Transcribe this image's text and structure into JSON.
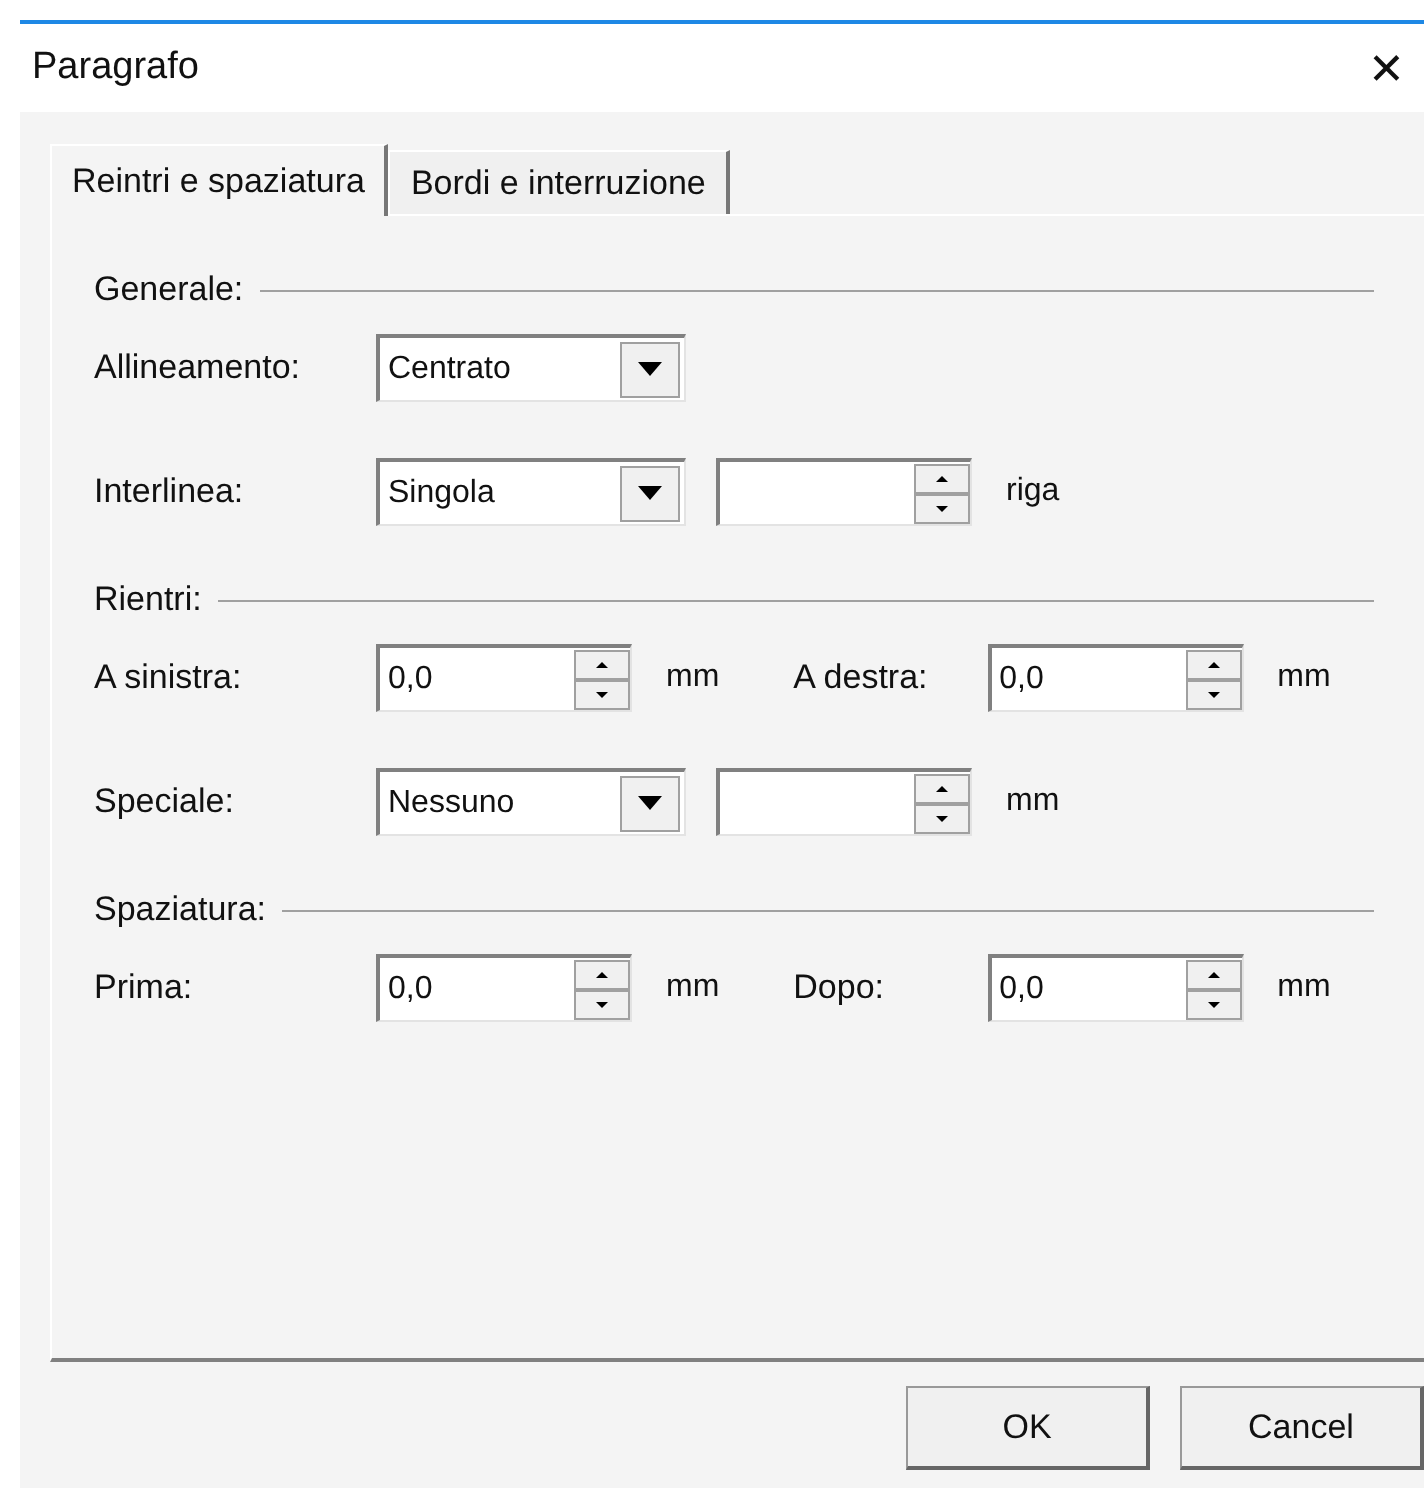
{
  "window": {
    "title": "Paragrafo",
    "close": "✕"
  },
  "tabs": [
    {
      "label": "Reintri e spaziatura",
      "selected": true
    },
    {
      "label": "Bordi e interruzione",
      "selected": false
    }
  ],
  "sections": [
    {
      "title": "Generale:",
      "rows": [
        {
          "label": "Allineamento:",
          "controls": [
            {
              "kind": "dropdown",
              "value": "Centrato"
            }
          ]
        },
        {
          "label": "Interlinea:",
          "controls": [
            {
              "kind": "dropdown",
              "value": "Singola"
            },
            {
              "kind": "spin"
            },
            {
              "kind": "unit",
              "text": "riga"
            }
          ]
        }
      ]
    },
    {
      "title": "Rientri:",
      "rows": [
        {
          "label": "A sinistra:",
          "controls": [
            {
              "kind": "spin",
              "value": "0,0"
            },
            {
              "kind": "unit",
              "text": "mm"
            },
            {
              "kind": "label",
              "text": "A destra:"
            },
            {
              "kind": "spin",
              "value": "0,0"
            },
            {
              "kind": "unit",
              "text": "mm"
            }
          ]
        },
        {
          "label": "Speciale:",
          "controls": [
            {
              "kind": "dropdown",
              "value": "Nessuno"
            },
            {
              "kind": "spin"
            },
            {
              "kind": "unit",
              "text": "mm"
            }
          ]
        }
      ]
    },
    {
      "title": "Spaziatura:",
      "rows": [
        {
          "label": "Prima:",
          "controls": [
            {
              "kind": "spin",
              "value": "0,0"
            },
            {
              "kind": "unit",
              "text": "mm"
            },
            {
              "kind": "label",
              "text": "Dopo:"
            },
            {
              "kind": "spin",
              "value": "0,0"
            },
            {
              "kind": "unit",
              "text": "mm"
            }
          ]
        }
      ]
    }
  ],
  "buttons": [
    "OK",
    "Cancel"
  ]
}
